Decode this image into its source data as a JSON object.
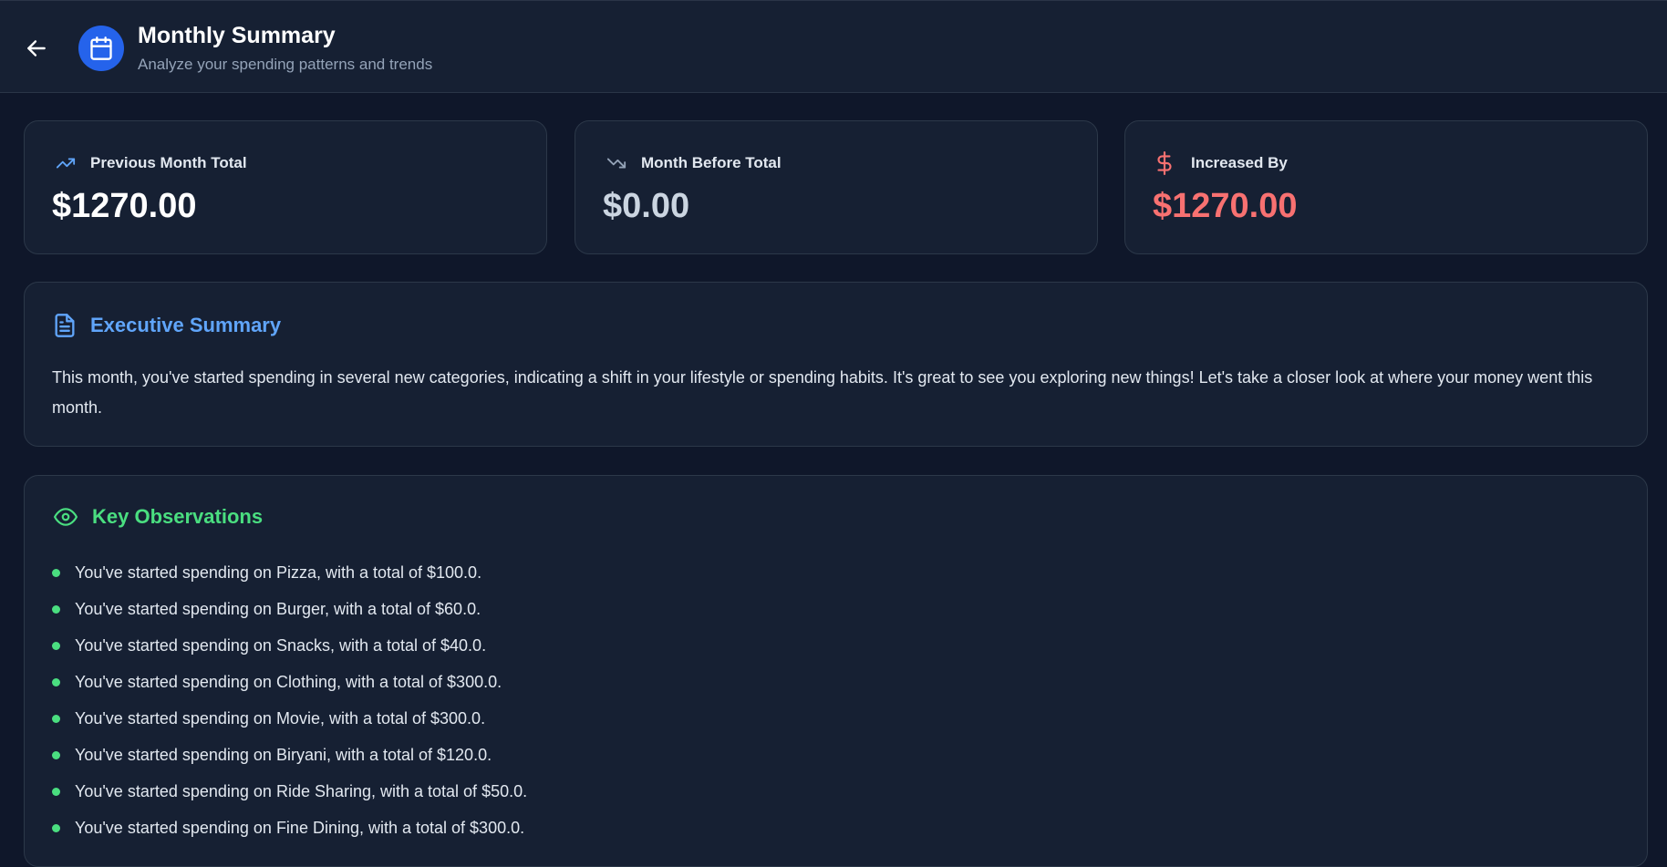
{
  "header": {
    "title": "Monthly Summary",
    "subtitle": "Analyze your spending patterns and trends",
    "back_icon": "arrow-left-icon",
    "header_icon": "calendar-icon"
  },
  "stats": [
    {
      "label": "Previous Month Total",
      "value": "$1270.00",
      "icon": "trending-up-icon",
      "icon_color": "#60a5fa",
      "value_color": "#ffffff"
    },
    {
      "label": "Month Before Total",
      "value": "$0.00",
      "icon": "trending-down-icon",
      "icon_color": "#94a3b8",
      "value_color": "#cbd5e1"
    },
    {
      "label": "Increased By",
      "value": "$1270.00",
      "icon": "dollar-icon",
      "icon_color": "#f87171",
      "value_color": "#f87171"
    }
  ],
  "executive_summary": {
    "title": "Executive Summary",
    "icon": "document-icon",
    "color": "#60a5fa",
    "text": "This month, you've started spending in several new categories, indicating a shift in your lifestyle or spending habits. It's great to see you exploring new things! Let's take a closer look at where your money went this month."
  },
  "key_observations": {
    "title": "Key Observations",
    "icon": "eye-icon",
    "color": "#4ade80",
    "items": [
      "You've started spending on Pizza, with a total of $100.0.",
      "You've started spending on Burger, with a total of $60.0.",
      "You've started spending on Snacks, with a total of $40.0.",
      "You've started spending on Clothing, with a total of $300.0.",
      "You've started spending on Movie, with a total of $300.0.",
      "You've started spending on Biryani, with a total of $120.0.",
      "You've started spending on Ride Sharing, with a total of $50.0.",
      "You've started spending on Fine Dining, with a total of $300.0."
    ]
  }
}
